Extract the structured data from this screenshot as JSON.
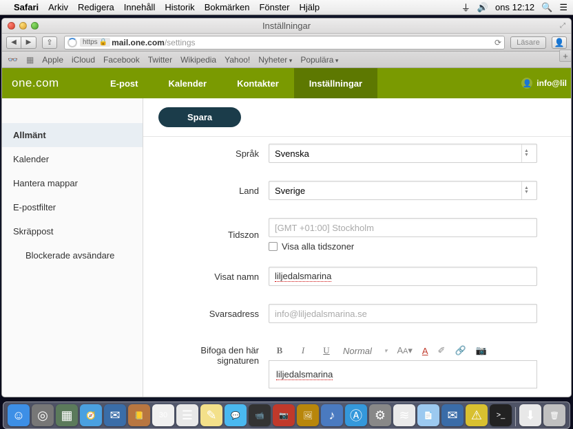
{
  "mac": {
    "app": "Safari",
    "menus": [
      "Arkiv",
      "Redigera",
      "Innehåll",
      "Historik",
      "Bokmärken",
      "Fönster",
      "Hjälp"
    ],
    "clock": "ons 12:12"
  },
  "window": {
    "title": "Inställningar"
  },
  "toolbar": {
    "reader": "Läsare"
  },
  "url": {
    "scheme": "https",
    "host": "mail.one.com",
    "path": "/settings"
  },
  "bookmarks": [
    "Apple",
    "iCloud",
    "Facebook",
    "Twitter",
    "Wikipedia",
    "Yahoo!",
    "Nyheter",
    "Populära"
  ],
  "logo": "one.com",
  "nav": {
    "items": [
      "E-post",
      "Kalender",
      "Kontakter",
      "Inställningar"
    ],
    "active": 3
  },
  "user": "info@lil",
  "sidebar": {
    "items": [
      "Allmänt",
      "Kalender",
      "Hantera mappar",
      "E-postfilter",
      "Skräppost"
    ],
    "subitem": "Blockerade avsändare",
    "active": 0
  },
  "form": {
    "save": "Spara",
    "labels": {
      "language": "Språk",
      "country": "Land",
      "timezone": "Tidszon",
      "show_all_tz": "Visa alla tidszoner",
      "display_name": "Visat namn",
      "reply_to": "Svarsadress",
      "signature": "Bifoga den här signaturen"
    },
    "values": {
      "language": "Svenska",
      "country": "Sverige",
      "timezone": "[GMT +01:00] Stockholm",
      "display_name": "liljedalsmarina",
      "reply_to": "info@liljedalsmarina.se",
      "signature_text": "liljedalsmarina"
    },
    "rte": {
      "normal": "Normal"
    }
  },
  "dock": [
    {
      "name": "finder",
      "bg": "#3d8fe6",
      "glyph": "☺"
    },
    {
      "name": "launchpad",
      "bg": "#777",
      "glyph": "◎"
    },
    {
      "name": "mission",
      "bg": "#5b7a5b",
      "glyph": "▦"
    },
    {
      "name": "safari",
      "bg": "#4aa0e0",
      "glyph": "🧭"
    },
    {
      "name": "mail",
      "bg": "#3a6da8",
      "glyph": "✉"
    },
    {
      "name": "contacts",
      "bg": "#b87640",
      "glyph": "📒"
    },
    {
      "name": "calendar",
      "bg": "#f0f0f0",
      "glyph": "30"
    },
    {
      "name": "reminders",
      "bg": "#e8e8e8",
      "glyph": "☰"
    },
    {
      "name": "notes",
      "bg": "#f3e08a",
      "glyph": "✎"
    },
    {
      "name": "messages",
      "bg": "#4ab8f0",
      "glyph": "💬"
    },
    {
      "name": "facetime",
      "bg": "#333",
      "glyph": "📹"
    },
    {
      "name": "photobooth",
      "bg": "#c0392b",
      "glyph": "📷"
    },
    {
      "name": "iphoto",
      "bg": "#b8860b",
      "glyph": "🖼"
    },
    {
      "name": "itunes",
      "bg": "#4a7ac0",
      "glyph": "♪"
    },
    {
      "name": "appstore",
      "bg": "#3498db",
      "glyph": "Ⓐ"
    },
    {
      "name": "sysprefs",
      "bg": "#888",
      "glyph": "⚙"
    },
    {
      "name": "openoffice",
      "bg": "#eaeaea",
      "glyph": "≋"
    },
    {
      "name": "textedit",
      "bg": "#9cc9f0",
      "glyph": "📄"
    },
    {
      "name": "thunderbird",
      "bg": "#3a6ca8",
      "glyph": "✉"
    },
    {
      "name": "warning",
      "bg": "#d8c030",
      "glyph": "⚠"
    },
    {
      "name": "terminal",
      "bg": "#222",
      "glyph": ">_"
    },
    {
      "name": "downloads",
      "bg": "#e8e8e8",
      "glyph": "⬇"
    },
    {
      "name": "trash",
      "bg": "#c0c0c0",
      "glyph": "🗑"
    }
  ]
}
